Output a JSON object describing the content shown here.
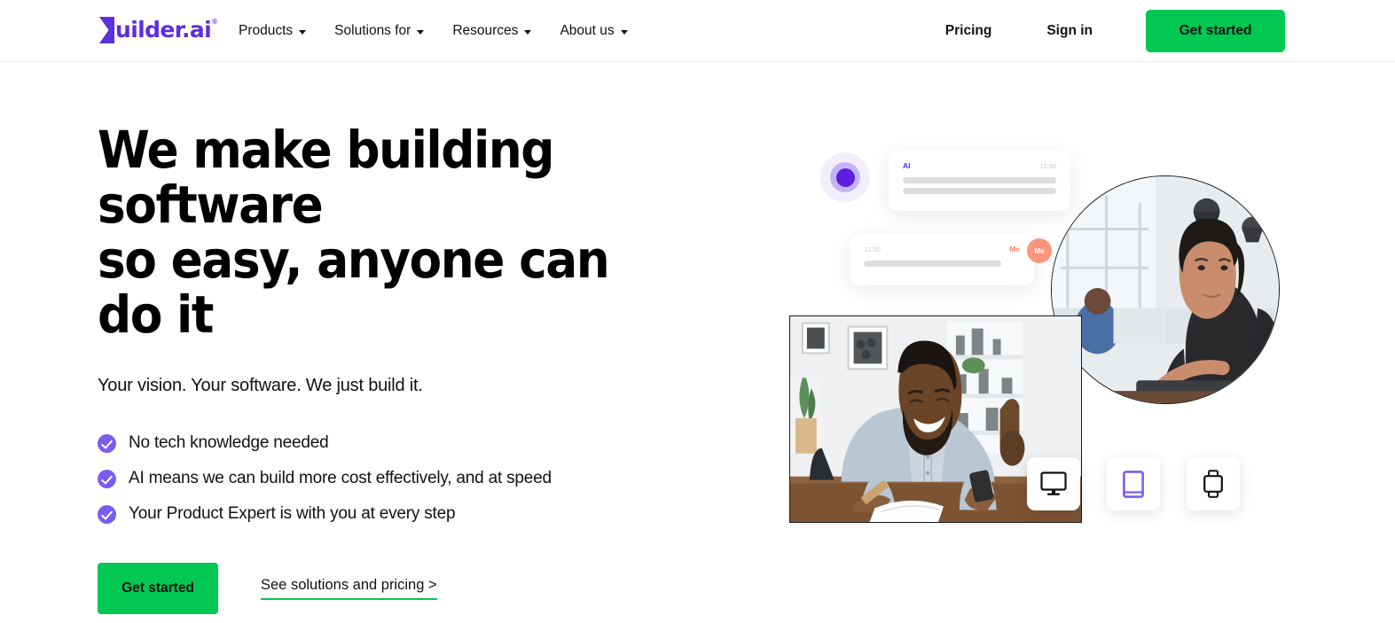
{
  "header": {
    "logo": {
      "mark": "B",
      "text": "uilder.ai",
      "reg": "®"
    },
    "nav": [
      {
        "label": "Products",
        "has_caret": true,
        "icon": "chevron-down-icon"
      },
      {
        "label": "Solutions for",
        "has_caret": true,
        "icon": "chevron-down-icon"
      },
      {
        "label": "Resources",
        "has_caret": true,
        "icon": "chevron-down-icon"
      },
      {
        "label": "About us",
        "has_caret": true,
        "icon": "chevron-down-icon"
      }
    ],
    "pricing_label": "Pricing",
    "signin_label": "Sign in",
    "get_started_label": "Get started"
  },
  "hero": {
    "title": "We make building software\nso easy, anyone can do it",
    "subtitle": "Your vision. Your software. We just build it.",
    "bullets": [
      {
        "text": "No tech knowledge needed",
        "icon": "check-circle-icon"
      },
      {
        "text": "AI means we can build more cost effectively, and at speed",
        "icon": "check-circle-icon"
      },
      {
        "text": "Your Product Expert is with you at every step",
        "icon": "check-circle-icon"
      }
    ],
    "cta_primary": "Get started",
    "cta_secondary": "See solutions and pricing >"
  },
  "collage": {
    "chat_ai": {
      "label": "AI",
      "time": "12:30"
    },
    "chat_me": {
      "label": "Me",
      "time": "12:30",
      "avatar_initials": "Me"
    },
    "devices": [
      {
        "name": "desktop-icon",
        "active": false
      },
      {
        "name": "tablet-icon",
        "active": true
      },
      {
        "name": "watch-icon",
        "active": false
      }
    ]
  },
  "colors": {
    "brand_purple": "#5c2fe0",
    "accent_purple": "#7c5cf0",
    "green": "#00c853",
    "orange": "#f9957a",
    "text": "#111111"
  }
}
